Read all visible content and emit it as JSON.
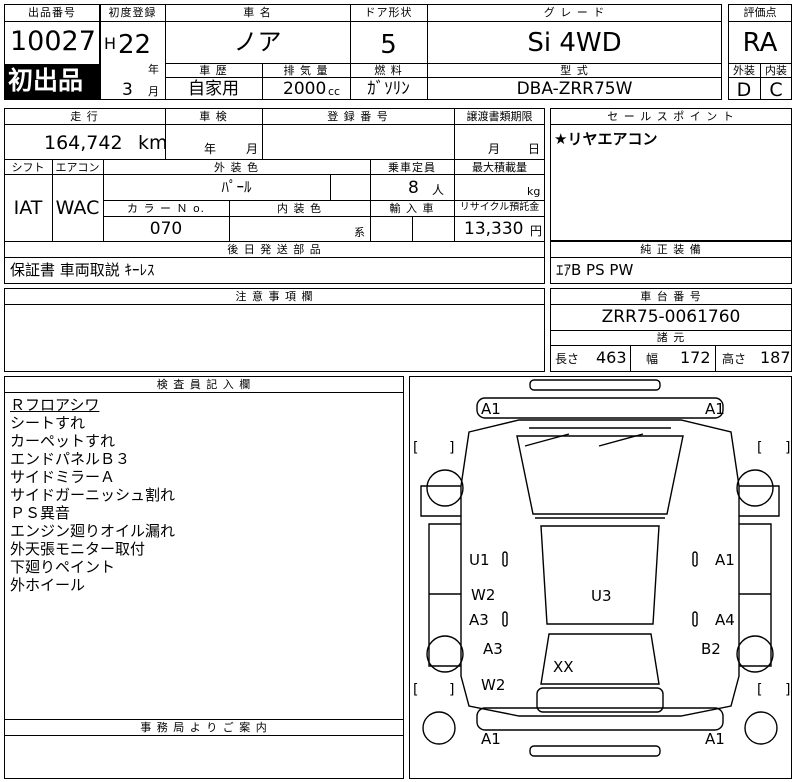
{
  "header": {
    "lot_label": "出品番号",
    "lot_no": "10027",
    "first_badge": "初出品",
    "reg_label": "初度登録",
    "era": "H",
    "year": "22",
    "year_unit": "年",
    "month": "3",
    "month_unit": "月",
    "car_name_label": "車 名",
    "car_name": "ノア",
    "history_label": "車 歴",
    "history": "自家用",
    "displacement_label": "排 気 量",
    "displacement": "2000",
    "displacement_unit": "cc",
    "door_label": "ドア形状",
    "doors": "5",
    "fuel_label": "燃 料",
    "fuel": "ｶﾞｿﾘﾝ",
    "grade_label": "グ レ ー ド",
    "grade": "Si 4WD",
    "model_label": "型 式",
    "model": "DBA-ZRR75W",
    "score_label": "評価点",
    "score": "RA",
    "ext_label": "外装",
    "int_label": "内装",
    "ext_grade": "D",
    "int_grade": "C"
  },
  "row2": {
    "mileage_label": "走 行",
    "mileage": "164,742",
    "mileage_unit": "km",
    "inspection_label": "車 検",
    "insp_year_unit": "年",
    "insp_month_unit": "月",
    "plate_label": "登 録 番 号",
    "transfer_label": "譲渡書類期限",
    "transfer_month_unit": "月",
    "transfer_day_unit": "日",
    "selling_label": "セ ー ル ス ポ イ ン ト",
    "selling_point": "★リヤエアコン"
  },
  "row3": {
    "shift_label": "シフト",
    "ac_label": "エアコン",
    "shift": "IAT",
    "ac": "WAC",
    "color_label": "外 装 色",
    "color": "ﾊﾟｰﾙ",
    "capacity_label": "乗車定員",
    "capacity": "8",
    "capacity_unit": "人",
    "load_label": "最大積載量",
    "load_unit": "kg",
    "color_no_label": "カ ラ ー Ｎ o.",
    "color_no": "070",
    "interior_color_label": "内 装 色",
    "interior_unit": "系",
    "import_label": "輸 入 車",
    "recycle_label": "リサイクル預託金",
    "recycle": "13,330",
    "recycle_unit": "円"
  },
  "row4": {
    "later_label": "後 日 発 送 部 品",
    "later": "保証書 車両取説 ｷｰﾚｽ",
    "equip_label": "純 正 装 備",
    "equip": "ｴｱB PS PW"
  },
  "row5": {
    "caution_label": "注 意 事 項 欄",
    "chassis_label": "車 台 番 号",
    "chassis": "ZRR75-0061760",
    "spec_label": "諸 元",
    "length_label": "長さ",
    "length": "463",
    "width_label": "幅",
    "width": "172",
    "height_label": "高さ",
    "height": "187"
  },
  "inspector": {
    "label": "検 査 員 記 入 欄",
    "notes": [
      "Ｒフロアシワ",
      "シートすれ",
      "カーペットすれ",
      "エンドパネルＢ３",
      "サイドミラーＡ",
      "サイドガーニッシュ割れ",
      "ＰＳ異音",
      "エンジン廻りオイル漏れ",
      "外天張モニター取付",
      "下廻りペイント",
      "外ホイール"
    ],
    "office_label": "事 務 局 よ り ご 案 内"
  },
  "diagram": {
    "marks": {
      "front_left": "A1",
      "front_right": "A1",
      "left_door_front": "U1",
      "right_door_front": "A1",
      "left_glass": "W2",
      "left_door_rear": "A3",
      "right_door_rear": "A4",
      "roof": "U3",
      "left_rear_fender": "A3",
      "right_rear_fender": "B2",
      "rear_glass": "W2",
      "tailgate": "XX",
      "rear_left": "A1",
      "rear_right": "A1"
    }
  }
}
